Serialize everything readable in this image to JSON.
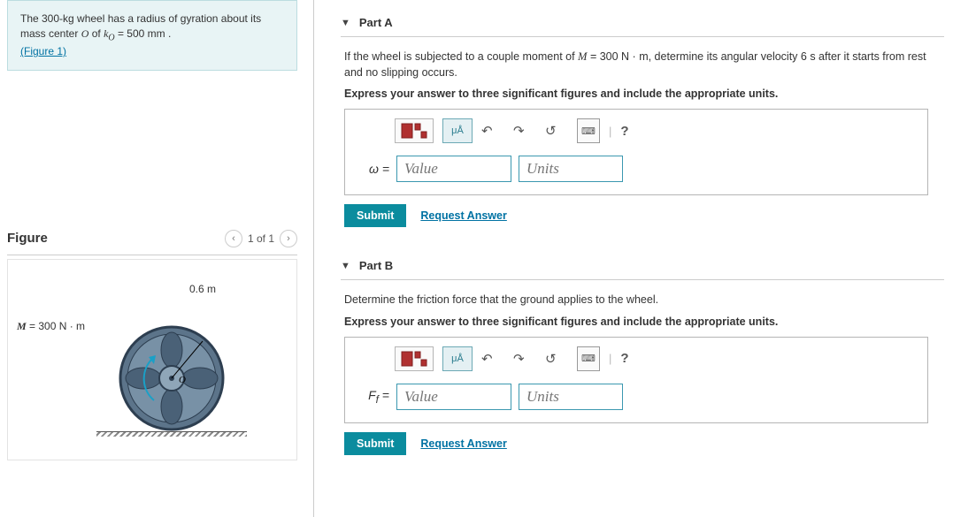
{
  "problem": {
    "text_before": "The 300-kg wheel has a radius of gyration about its mass center ",
    "var1": "O",
    "text_mid": " of ",
    "var2": "k",
    "var2_sub": "O",
    "text_eq": " = 500 mm .",
    "figure_link": "(Figure 1)"
  },
  "figure": {
    "heading": "Figure",
    "counter": "1 of 1",
    "radius_label": "0.6 m",
    "moment_label_pre": "M",
    "moment_label_post": " = 300 N · m",
    "center_label": "O"
  },
  "partA": {
    "title": "Part A",
    "question_pre": "If the wheel is subjected to a couple moment of ",
    "question_var": "M",
    "question_post": " = 300 N · m, determine its angular velocity 6 s after it starts from rest and no slipping occurs.",
    "instruction": "Express your answer to three significant figures and include the appropriate units.",
    "var_label": "ω =",
    "value_ph": "Value",
    "units_ph": "Units",
    "submit": "Submit",
    "request": "Request Answer"
  },
  "partB": {
    "title": "Part B",
    "question": "Determine the friction force that the ground applies to the wheel.",
    "instruction": "Express your answer to three significant figures and include the appropriate units.",
    "var_label_pre": "F",
    "var_label_sub": "f",
    "var_label_post": " =",
    "value_ph": "Value",
    "units_ph": "Units",
    "submit": "Submit",
    "request": "Request Answer"
  },
  "toolbar": {
    "units_btn": "μÅ",
    "help": "?"
  }
}
